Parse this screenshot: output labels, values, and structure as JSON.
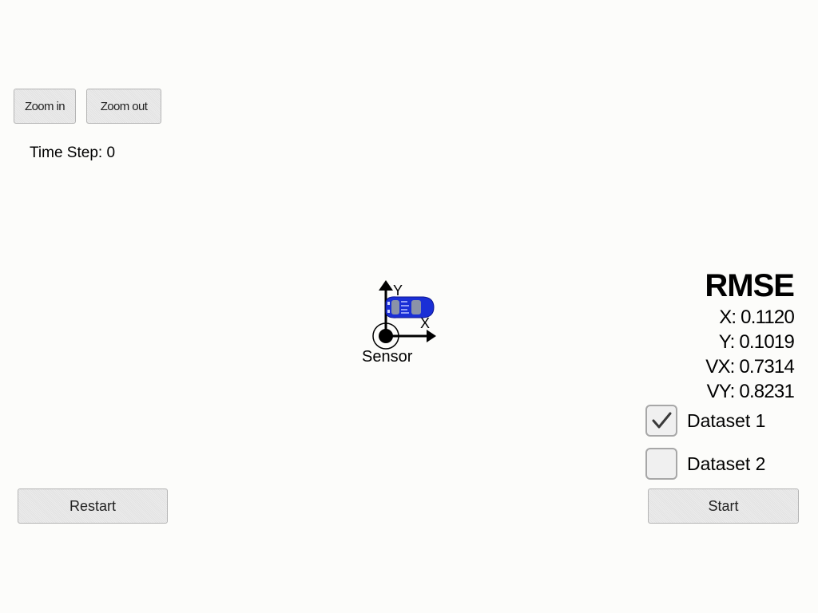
{
  "toolbar": {
    "zoom_in_label": "Zoom in",
    "zoom_out_label": "Zoom out"
  },
  "status": {
    "time_step": "Time Step: 0"
  },
  "scene": {
    "x_axis_label": "X",
    "y_axis_label": "Y",
    "sensor_label": "Sensor",
    "car_color": "#1a2fd6"
  },
  "rmse": {
    "title": "RMSE",
    "x": "X: 0.1120",
    "y": "Y: 0.1019",
    "vx": "VX: 0.7314",
    "vy": "VY: 0.8231"
  },
  "datasets": [
    {
      "label": "Dataset 1",
      "checked": true
    },
    {
      "label": "Dataset 2",
      "checked": false
    }
  ],
  "controls": {
    "restart_label": "Restart",
    "start_label": "Start"
  }
}
